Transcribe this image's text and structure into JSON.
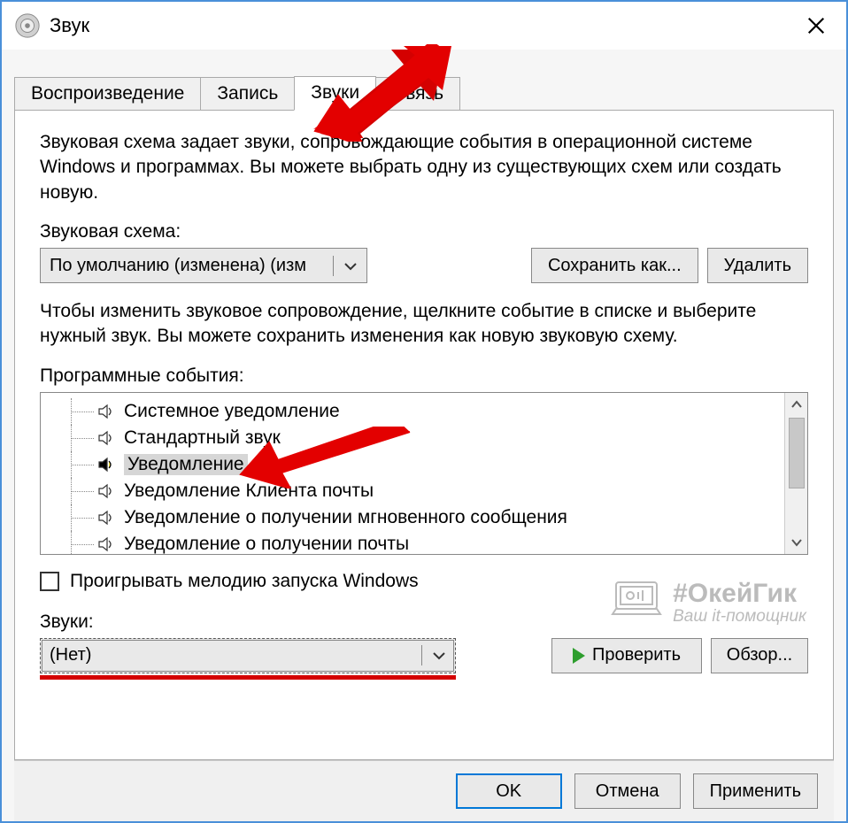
{
  "window": {
    "title": "Звук"
  },
  "tabs": [
    {
      "label": "Воспроизведение",
      "active": false
    },
    {
      "label": "Запись",
      "active": false
    },
    {
      "label": "Звуки",
      "active": true
    },
    {
      "label": "Связь",
      "active": false
    }
  ],
  "panel": {
    "description": "Звуковая схема задает звуки, сопровождающие события в операционной системе Windows и программах. Вы можете выбрать одну из существующих схем или создать новую.",
    "scheme_label": "Звуковая схема:",
    "scheme_value": "По умолчанию (изменена) (изм",
    "save_as": "Сохранить как...",
    "delete": "Удалить",
    "events_desc": "Чтобы изменить звуковое сопровождение, щелкните событие в списке и выберите нужный звук. Вы можете сохранить изменения как новую звуковую схему.",
    "events_label": "Программные события:",
    "events": [
      {
        "label": "Системное уведомление",
        "selected": false,
        "hasSound": false
      },
      {
        "label": "Стандартный звук",
        "selected": false,
        "hasSound": false
      },
      {
        "label": "Уведомление",
        "selected": true,
        "hasSound": true
      },
      {
        "label": "Уведомление Клиента почты",
        "selected": false,
        "hasSound": false
      },
      {
        "label": "Уведомление о получении мгновенного сообщения",
        "selected": false,
        "hasSound": false
      },
      {
        "label": "Уведомление о получении почты",
        "selected": false,
        "hasSound": false
      }
    ],
    "play_startup": "Проигрывать мелодию запуска Windows",
    "sounds_label": "Звуки:",
    "sounds_value": "(Нет)",
    "test": "Проверить",
    "browse": "Обзор..."
  },
  "footer": {
    "ok": "OK",
    "cancel": "Отмена",
    "apply": "Применить"
  },
  "watermark": {
    "line1": "#ОкейГик",
    "line2": "Ваш it-помощник"
  }
}
